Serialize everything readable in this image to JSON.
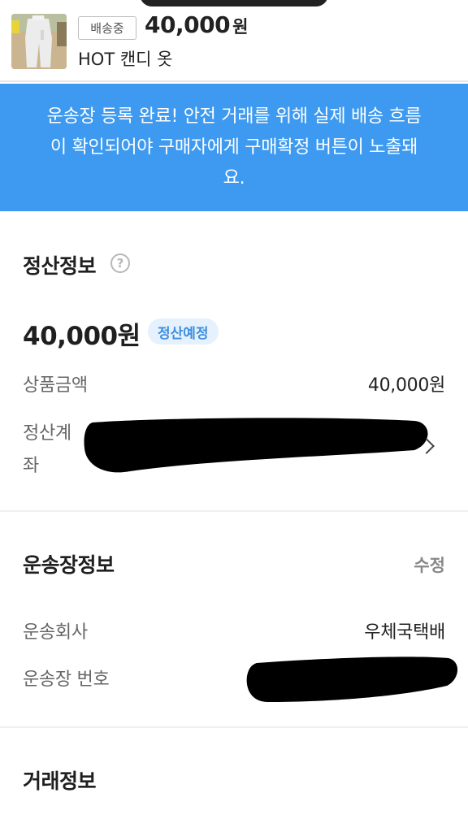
{
  "product": {
    "status_badge": "배송중",
    "price": "40,000",
    "price_unit": "원",
    "name": "HOT 캔디 옷"
  },
  "notice": {
    "line1": "운송장 등록 완료! 안전 거래를 위해 실제 배송 흐름",
    "line2": "이 확인되어야 구매자에게 구매확정 버튼이 노출돼",
    "line3": "요."
  },
  "settlement": {
    "title": "정산정보",
    "help_icon": "question-circle-icon",
    "amount": "40,000원",
    "status": "정산예정",
    "rows": [
      {
        "label": "상품금액",
        "value": "40,000원"
      },
      {
        "label_line1": "정산계",
        "label_line2": "좌",
        "value_redacted": true
      }
    ]
  },
  "shipping": {
    "title": "운송장정보",
    "edit_label": "수정",
    "rows": [
      {
        "label": "운송회사",
        "value": "우체국택배"
      },
      {
        "label": "운송장 번호",
        "value_redacted": true
      }
    ]
  },
  "transaction": {
    "title": "거래정보"
  },
  "colors": {
    "notice_bg": "#3d9af0",
    "status_pill_bg": "#e5f1fd",
    "status_pill_text": "#3d8fe0"
  }
}
